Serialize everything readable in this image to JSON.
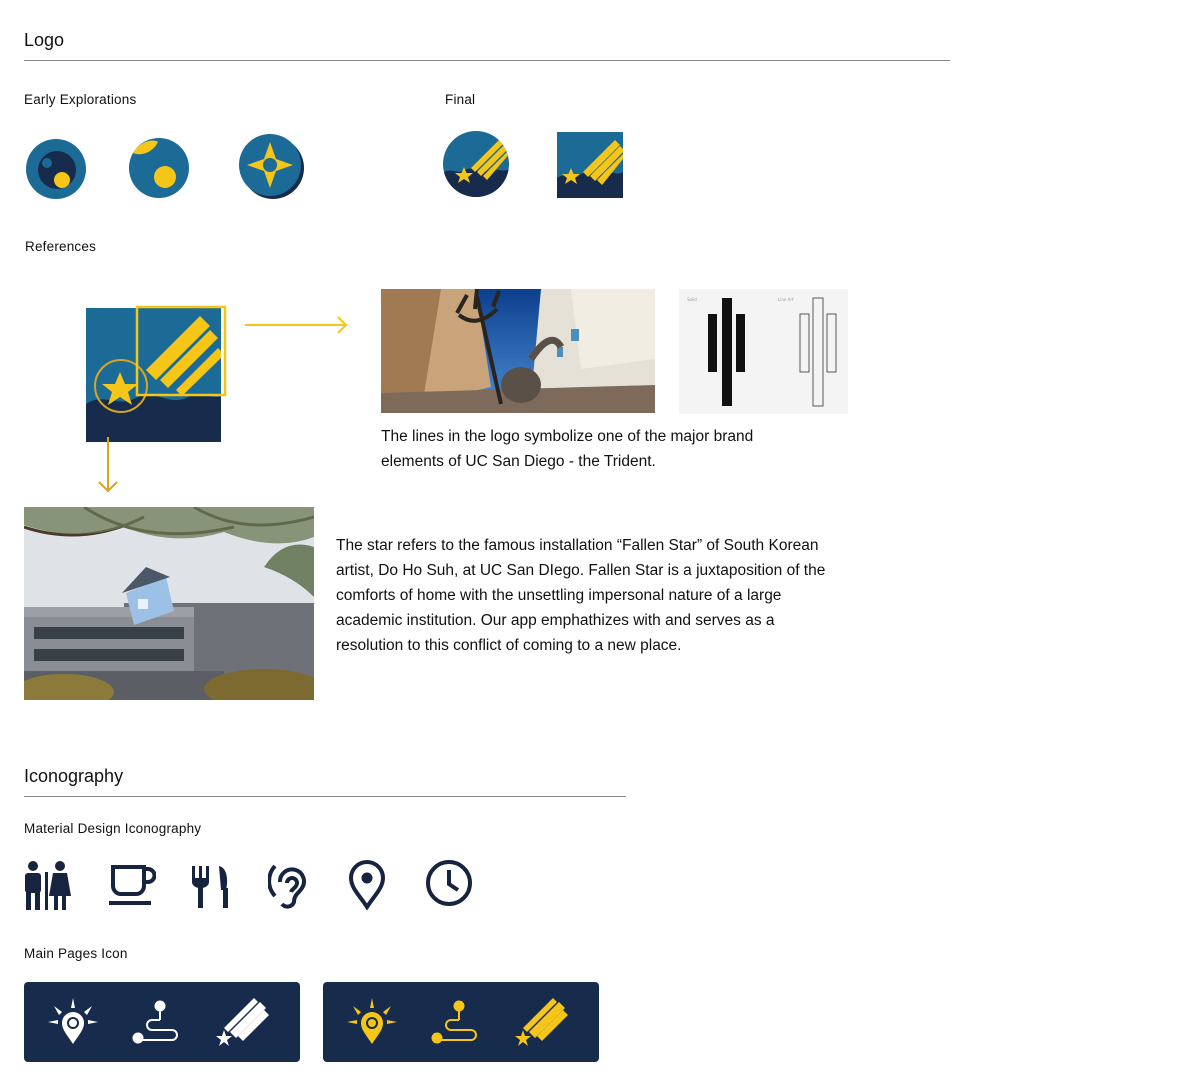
{
  "logo": {
    "heading": "Logo",
    "early_label": "Early Explorations",
    "final_label": "Final",
    "references_label": "References",
    "trident_text": "The lines in the logo symbolize one of the major brand elements of UC San Diego - the Trident.",
    "star_text": "The star refers to the famous installation “Fallen Star” of South Korean artist, Do Ho Suh, at UC San DIego. Fallen Star is a juxtaposition of the comforts of home with the unsettling impersonal nature of a large academic institution. Our app emphathizes with and serves as a resolution to this conflict of coming to a new place.",
    "trident_sheet": {
      "label_left": "Solid",
      "label_right": "Line Art"
    }
  },
  "iconography": {
    "heading": "Iconography",
    "material_label": "Material Design Iconography",
    "material_icons": [
      "restroom-icon",
      "coffee-icon",
      "restaurant-icon",
      "hearing-icon",
      "location-pin-icon",
      "clock-icon"
    ],
    "main_pages_label": "Main Pages Icon",
    "main_pages_sets": [
      {
        "variant": "white",
        "icons": [
          "explore-icon",
          "route-icon",
          "shooting-star-icon"
        ]
      },
      {
        "variant": "yellow",
        "icons": [
          "explore-icon",
          "route-icon",
          "shooting-star-icon"
        ]
      }
    ]
  },
  "colors": {
    "brand_blue": "#1c6a96",
    "navy": "#172b4d",
    "gold": "#f5c518",
    "arrow_gold": "#d9a520",
    "icon_dark": "#17243f"
  }
}
